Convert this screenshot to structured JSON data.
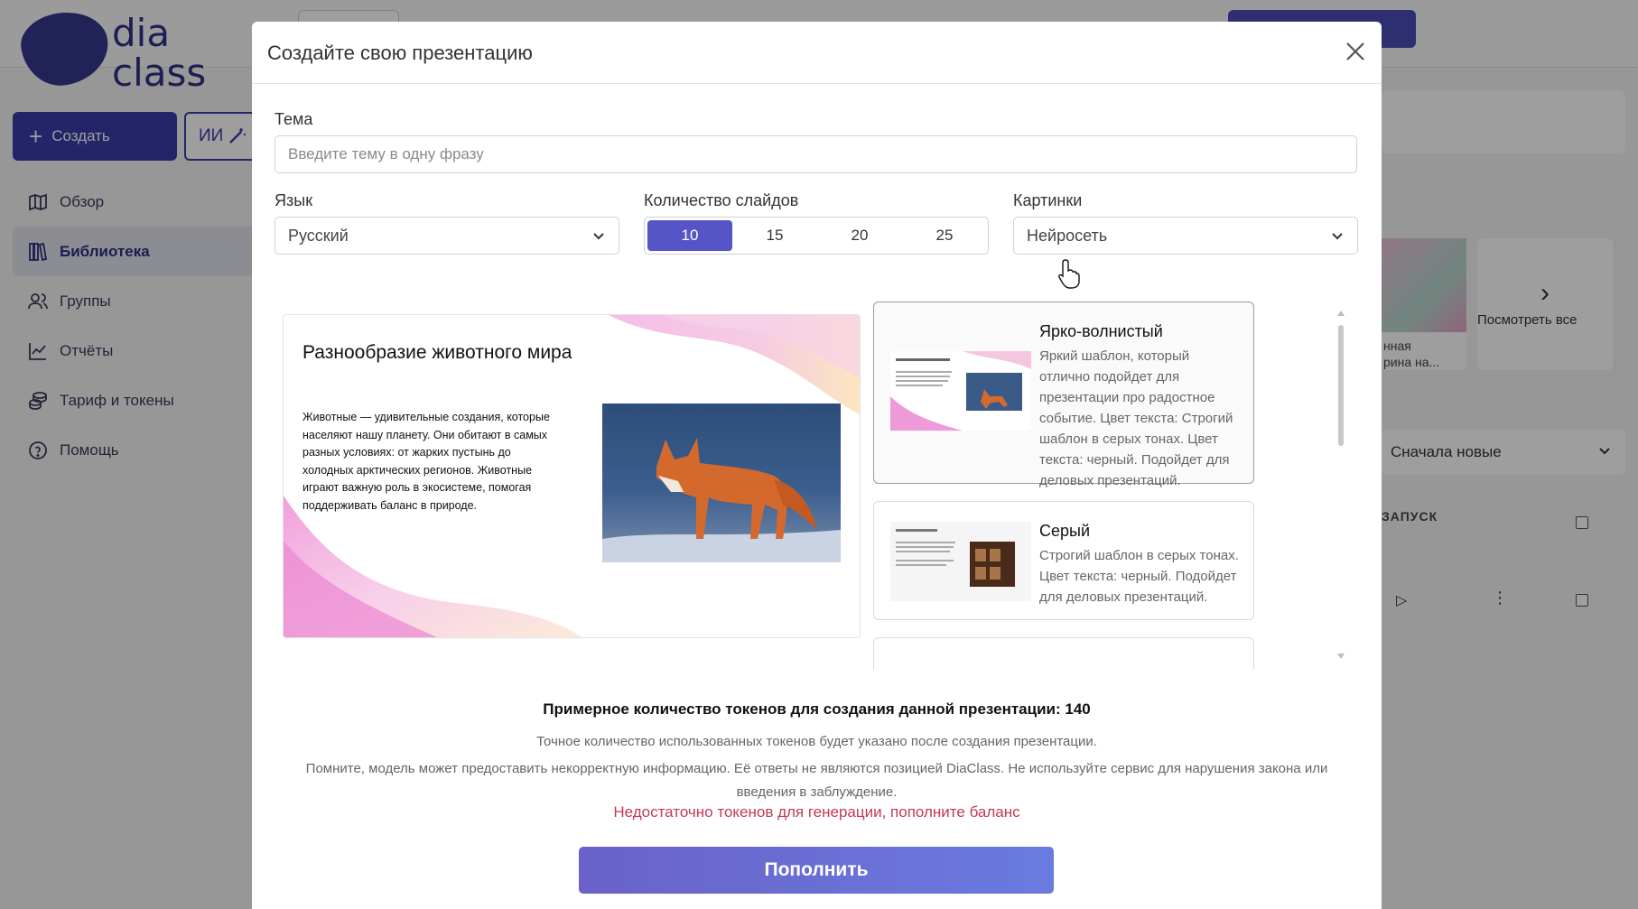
{
  "background": {
    "logo": {
      "word1": "dia",
      "word2": "class"
    },
    "create_button": "Создать",
    "ai_button": "ИИ",
    "nav": [
      {
        "label": "Обзор",
        "icon": "map-icon",
        "active": false
      },
      {
        "label": "Библиотека",
        "icon": "books-icon",
        "active": true
      },
      {
        "label": "Группы",
        "icon": "users-icon",
        "active": false
      },
      {
        "label": "Отчёты",
        "icon": "chart-line-icon",
        "active": false
      },
      {
        "label": "Тариф и токены",
        "icon": "coins-icon",
        "active": false
      },
      {
        "label": "Помощь",
        "icon": "help-circle-icon",
        "active": false
      }
    ],
    "recent_item_text": "нная\nрина на...",
    "see_all": "Посмотреть все",
    "sort_label": "Сначала новые",
    "table_header": "ЗАПУСК"
  },
  "modal": {
    "title": "Создайте свою презентацию",
    "topic": {
      "label": "Тема",
      "placeholder": "Введите тему в одну фразу",
      "value": ""
    },
    "language": {
      "label": "Язык",
      "selected": "Русский"
    },
    "slides": {
      "label": "Количество слайдов",
      "options": [
        "10",
        "15",
        "20",
        "25"
      ],
      "selected": "10"
    },
    "images": {
      "label": "Картинки",
      "selected": "Нейросеть"
    },
    "preview": {
      "title": "Разнообразие животного мира",
      "text": "Животные — удивительные создания, которые населяют нашу планету. Они обитают в самых разных условиях: от жарких пустынь до холодных арктических регионов. Животные играют важную роль в экосистеме, помогая поддерживать баланс в природе."
    },
    "templates": [
      {
        "name": "Ярко-волнистый",
        "description": "Яркий шаблон, который отлично подойдет для презентации про радостное событие. Цвет текста: Строгий шаблон в серых тонах. Цвет текста: черный. Подойдет для деловых презентаций.",
        "selected": true
      },
      {
        "name": "Серый",
        "description": "Строгий шаблон в серых тонах. Цвет текста: черный. Подойдет для деловых презентаций.",
        "selected": false
      }
    ],
    "tokens_estimate": "Примерное количество токенов для создания данной презентации: 140",
    "tokens_note": "Точное количество использованных токенов будет указано после создания презентации.",
    "disclaimer": "Помните, модель может предоставить некорректную информацию. Её ответы не являются позицией DiaClass. Не используйте сервис для нарушения закона или введения в заблуждение.",
    "error": "Недостаточно токенов для генерации, пополните баланс",
    "topup_button": "Пополнить"
  },
  "colors": {
    "accent": "#5655c8",
    "brand_dark": "#3b3da9",
    "error": "#c03a55"
  }
}
